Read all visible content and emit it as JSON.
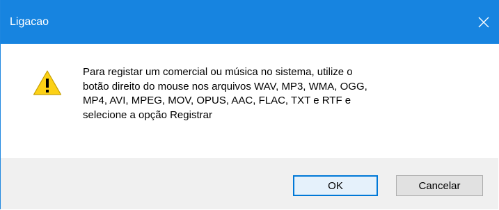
{
  "window": {
    "title": "Ligacao",
    "close_icon": "close-icon"
  },
  "message": {
    "icon": "warning-icon",
    "lines": [
      "Para registar um comercial ou música no sistema, utilize o",
      "botão direito do mouse nos arquivos WAV, MP3, WMA, OGG,",
      "MP4, AVI, MPEG, MOV, OPUS, AAC, FLAC, TXT e RTF e",
      "selecione a opção Registrar"
    ]
  },
  "buttons": {
    "ok_label": "OK",
    "cancel_label": "Cancelar"
  },
  "colors": {
    "titlebar": "#1784e0",
    "footer": "#f0f0f0",
    "warning_fill": "#fcd116",
    "focus_border": "#0078d7"
  }
}
